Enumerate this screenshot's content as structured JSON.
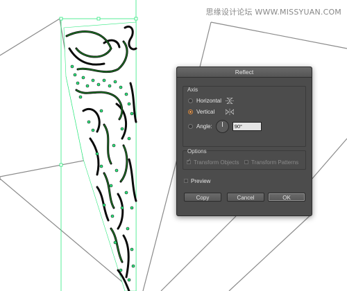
{
  "watermark": "思缘设计论坛 WWW.MISSYUAN.COM",
  "dialog": {
    "title": "Reflect",
    "axis": {
      "label": "Axis",
      "horizontal": "Horizontal",
      "vertical": "Vertical",
      "selected": "Vertical",
      "angle_label": "Angle:",
      "angle_value": "90°"
    },
    "options": {
      "label": "Options",
      "transform_objects": "Transform Objects",
      "transform_objects_checked": true,
      "transform_patterns": "Transform Patterns",
      "transform_patterns_checked": false
    },
    "preview": {
      "label": "Preview",
      "checked": false
    },
    "buttons": {
      "copy": "Copy",
      "cancel": "Cancel",
      "ok": "OK"
    }
  },
  "colors": {
    "selection": "#2ee87e",
    "artwork_fill": "#1f8a2a",
    "artwork_stroke": "#0b0b0b",
    "dialog_bg": "#4c4c4c",
    "radio_accent": "#f0a25a"
  }
}
